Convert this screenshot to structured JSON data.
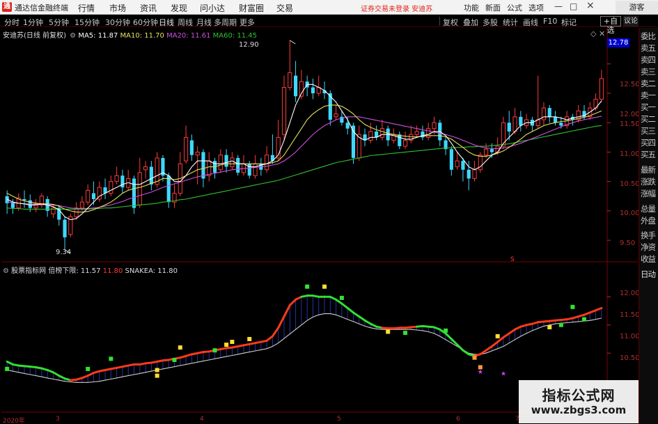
{
  "app": {
    "logo_text": "通",
    "title": "通达信金融终端"
  },
  "menu": [
    "行情",
    "市场",
    "资讯",
    "发现",
    "问小达",
    "财富圈",
    "交易"
  ],
  "trade_warning": "证券交易未登录 安迪苏",
  "top_right_buttons": [
    "功能",
    "新面",
    "公式",
    "选项"
  ],
  "window_controls": [
    "—",
    "□",
    "×"
  ],
  "guest_label": "游客",
  "periods": [
    "分时",
    "1分钟",
    "5分钟",
    "15分钟",
    "30分钟",
    "60分钟",
    "日线",
    "周线",
    "月线",
    "多周期",
    "更多"
  ],
  "active_period": "日线",
  "toolbar_right": [
    "复权",
    "叠加",
    "多股",
    "统计",
    "画线",
    "F10",
    "标记"
  ],
  "self_select_label": "+自选",
  "yk_label": "议论",
  "sidebar": {
    "top": "委比",
    "items": [
      "委比",
      "卖五",
      "卖四",
      "卖三",
      "卖二",
      "卖一",
      "买一",
      "买二",
      "买三",
      "买四",
      "买五",
      "最新",
      "涨跌",
      "涨幅",
      "总量",
      "外盘",
      "换手",
      "净资",
      "收益"
    ],
    "bottom": "日线"
  },
  "main_legend": {
    "stock": "安迪苏",
    "mode": "(日线 前复权)",
    "ma5_label": "MA5: 11.87",
    "ma10_label": "MA10: 11.70",
    "ma20_label": "MA20: 11.61",
    "ma60_label": "MA60: 11.45"
  },
  "price_axis": [
    "12.50",
    "12.00",
    "11.50",
    "11.00",
    "10.50",
    "10.00",
    "9.50"
  ],
  "current_price": "12.78",
  "high_marker": "12.90",
  "low_marker": "9.34",
  "flag_marker": "S",
  "indicator_legend": {
    "name": "股票指标网",
    "item1": "倍榜下限: 11.57",
    "item2": "11.80",
    "item3": "SNAKEA: 11.80"
  },
  "indicator_axis": [
    "12.00",
    "11.50",
    "11.00",
    "10.50"
  ],
  "indicator_panel_label": "日动",
  "x_axis": [
    "2020年",
    "3",
    "4",
    "5",
    "6",
    "7"
  ],
  "watermark": {
    "line1": "指标公式网",
    "line2": "www.zbgs3.com"
  },
  "colors": {
    "up": "#ff3b3b",
    "down": "#3fd8ff",
    "ma5": "#ffffff",
    "ma10": "#e8e060",
    "ma20": "#d050e0",
    "ma60": "#30c030",
    "accent": "#e0261e"
  },
  "chart_data": {
    "type": "candlestick",
    "ylim": [
      9.3,
      12.9
    ],
    "candles": [
      [
        10.25,
        10.13,
        10.35,
        9.95
      ],
      [
        10.15,
        10.05,
        10.2,
        9.95
      ],
      [
        10.05,
        10.22,
        10.3,
        10.0
      ],
      [
        10.2,
        10.18,
        10.35,
        10.05
      ],
      [
        10.18,
        10.05,
        10.28,
        9.98
      ],
      [
        10.05,
        10.12,
        10.2,
        9.98
      ],
      [
        10.1,
        10.25,
        10.3,
        10.05
      ],
      [
        10.2,
        10.0,
        10.25,
        9.9
      ],
      [
        9.95,
        10.05,
        10.1,
        9.88
      ],
      [
        10.05,
        9.85,
        10.1,
        9.75
      ],
      [
        9.85,
        9.55,
        9.9,
        9.34
      ],
      [
        9.6,
        9.9,
        9.95,
        9.55
      ],
      [
        9.9,
        10.05,
        10.15,
        9.85
      ],
      [
        10.05,
        10.15,
        10.25,
        10.0
      ],
      [
        10.15,
        10.35,
        10.45,
        10.1
      ],
      [
        10.3,
        10.2,
        10.5,
        10.1
      ],
      [
        10.2,
        10.4,
        10.5,
        10.15
      ],
      [
        10.4,
        10.3,
        10.55,
        10.2
      ],
      [
        10.3,
        10.5,
        10.6,
        10.25
      ],
      [
        10.5,
        10.6,
        10.75,
        10.45
      ],
      [
        10.6,
        10.4,
        10.7,
        10.3
      ],
      [
        10.4,
        10.55,
        10.7,
        10.35
      ],
      [
        10.55,
        10.05,
        10.6,
        9.95
      ],
      [
        10.1,
        10.65,
        10.9,
        10.05
      ],
      [
        10.7,
        10.75,
        10.85,
        10.55
      ],
      [
        10.75,
        10.45,
        10.85,
        10.35
      ],
      [
        10.45,
        10.9,
        11.0,
        10.4
      ],
      [
        10.9,
        10.6,
        10.95,
        10.5
      ],
      [
        10.6,
        10.15,
        10.65,
        10.05
      ],
      [
        10.15,
        10.3,
        10.45,
        10.05
      ],
      [
        10.3,
        10.8,
        11.0,
        10.25
      ],
      [
        10.85,
        11.25,
        11.45,
        10.8
      ],
      [
        11.2,
        10.95,
        11.3,
        10.85
      ],
      [
        10.95,
        11.0,
        11.1,
        10.45
      ],
      [
        11.0,
        10.55,
        11.05,
        10.4
      ],
      [
        10.6,
        10.85,
        11.0,
        10.5
      ],
      [
        10.85,
        10.65,
        10.9,
        10.55
      ],
      [
        10.7,
        10.95,
        11.05,
        10.65
      ],
      [
        10.95,
        10.75,
        11.05,
        10.65
      ],
      [
        10.75,
        10.9,
        11.0,
        10.7
      ],
      [
        10.9,
        10.65,
        10.95,
        10.6
      ],
      [
        10.65,
        10.8,
        10.95,
        10.6
      ],
      [
        10.8,
        10.6,
        10.85,
        10.55
      ],
      [
        10.6,
        10.8,
        10.95,
        10.55
      ],
      [
        10.8,
        10.7,
        10.9,
        10.6
      ],
      [
        10.7,
        10.95,
        11.1,
        10.65
      ],
      [
        10.95,
        10.85,
        11.3,
        10.8
      ],
      [
        10.9,
        11.25,
        11.55,
        10.85
      ],
      [
        11.3,
        12.1,
        12.3,
        11.2
      ],
      [
        12.1,
        12.35,
        12.9,
        12.05
      ],
      [
        12.3,
        11.95,
        12.55,
        11.85
      ],
      [
        11.95,
        12.2,
        12.4,
        11.9
      ],
      [
        12.2,
        12.1,
        12.3,
        11.95
      ],
      [
        12.1,
        12.0,
        12.25,
        11.9
      ],
      [
        12.0,
        12.1,
        12.3,
        11.95
      ],
      [
        12.05,
        12.0,
        12.2,
        11.9
      ],
      [
        12.0,
        11.55,
        12.05,
        11.45
      ],
      [
        11.6,
        11.65,
        11.8,
        11.55
      ],
      [
        11.6,
        11.5,
        11.7,
        11.45
      ],
      [
        11.5,
        11.4,
        11.6,
        11.3
      ],
      [
        11.45,
        10.9,
        11.5,
        10.8
      ],
      [
        10.9,
        11.3,
        11.45,
        10.85
      ],
      [
        11.3,
        11.2,
        11.4,
        11.1
      ],
      [
        11.2,
        11.35,
        11.5,
        11.15
      ],
      [
        11.35,
        11.25,
        11.45,
        11.2
      ],
      [
        11.25,
        11.4,
        11.55,
        11.2
      ],
      [
        11.4,
        11.2,
        11.45,
        11.1
      ],
      [
        11.2,
        11.3,
        11.4,
        11.15
      ],
      [
        11.3,
        11.1,
        11.35,
        11.05
      ],
      [
        11.1,
        11.2,
        11.35,
        11.05
      ],
      [
        11.2,
        11.3,
        11.45,
        11.15
      ],
      [
        11.3,
        11.35,
        11.45,
        11.25
      ],
      [
        11.35,
        11.25,
        11.45,
        11.2
      ],
      [
        11.25,
        11.4,
        11.5,
        11.2
      ],
      [
        11.4,
        11.5,
        11.6,
        11.3
      ],
      [
        11.5,
        11.2,
        11.55,
        11.1
      ],
      [
        11.2,
        11.05,
        11.25,
        10.95
      ],
      [
        11.05,
        10.7,
        11.1,
        10.6
      ],
      [
        10.75,
        10.85,
        11.0,
        10.7
      ],
      [
        10.85,
        10.7,
        10.9,
        10.5
      ],
      [
        10.7,
        10.55,
        10.85,
        10.35
      ],
      [
        10.55,
        10.7,
        10.85,
        10.5
      ],
      [
        10.7,
        10.95,
        11.0,
        10.65
      ],
      [
        10.95,
        11.05,
        11.15,
        10.9
      ],
      [
        11.05,
        11.0,
        11.15,
        10.9
      ],
      [
        11.0,
        11.1,
        11.25,
        10.95
      ],
      [
        11.1,
        11.5,
        11.6,
        11.05
      ],
      [
        11.5,
        11.35,
        11.7,
        11.2
      ],
      [
        11.35,
        11.6,
        11.75,
        11.3
      ],
      [
        11.6,
        11.45,
        11.7,
        11.35
      ],
      [
        11.45,
        11.55,
        11.65,
        11.4
      ],
      [
        11.55,
        11.45,
        11.6,
        11.35
      ],
      [
        11.45,
        11.55,
        12.3,
        11.4
      ],
      [
        11.55,
        11.75,
        11.85,
        11.45
      ],
      [
        11.75,
        11.6,
        11.8,
        11.5
      ],
      [
        11.6,
        11.5,
        11.7,
        11.45
      ],
      [
        11.5,
        11.45,
        11.6,
        11.4
      ],
      [
        11.45,
        11.6,
        11.7,
        11.4
      ],
      [
        11.6,
        11.55,
        11.65,
        11.45
      ],
      [
        11.55,
        11.7,
        11.8,
        11.5
      ],
      [
        11.7,
        11.6,
        11.8,
        11.55
      ],
      [
        11.6,
        11.75,
        11.85,
        11.55
      ],
      [
        11.75,
        11.9,
        12.0,
        11.7
      ],
      [
        11.9,
        12.25,
        12.4,
        11.85
      ]
    ],
    "ma5": [
      10.2,
      10.15,
      10.13,
      10.12,
      10.1,
      10.1,
      10.12,
      10.1,
      10.07,
      10.02,
      9.9,
      9.85,
      9.87,
      9.95,
      10.05,
      10.15,
      10.25,
      10.3,
      10.35,
      10.4,
      10.45,
      10.48,
      10.45,
      10.45,
      10.5,
      10.55,
      10.6,
      10.65,
      10.6,
      10.5,
      10.5,
      10.6,
      10.75,
      10.85,
      10.85,
      10.85,
      10.8,
      10.8,
      10.82,
      10.85,
      10.8,
      10.8,
      10.75,
      10.75,
      10.78,
      10.8,
      10.85,
      10.95,
      11.2,
      11.5,
      11.8,
      12.0,
      12.15,
      12.15,
      12.1,
      12.05,
      11.95,
      11.85,
      11.7,
      11.55,
      11.35,
      11.25,
      11.2,
      11.25,
      11.25,
      11.3,
      11.3,
      11.28,
      11.25,
      11.22,
      11.22,
      11.25,
      11.28,
      11.3,
      11.35,
      11.35,
      11.28,
      11.15,
      11.0,
      10.88,
      10.75,
      10.7,
      10.75,
      10.85,
      10.95,
      11.0,
      11.15,
      11.25,
      11.35,
      11.45,
      11.5,
      11.5,
      11.55,
      11.6,
      11.6,
      11.6,
      11.58,
      11.55,
      11.58,
      11.6,
      11.62,
      11.68,
      11.75,
      11.87
    ],
    "ma10": [
      10.3,
      10.25,
      10.2,
      10.17,
      10.15,
      10.13,
      10.12,
      10.12,
      10.11,
      10.08,
      10.03,
      10.0,
      9.98,
      9.98,
      9.99,
      10.02,
      10.06,
      10.1,
      10.15,
      10.22,
      10.3,
      10.35,
      10.38,
      10.4,
      10.43,
      10.47,
      10.5,
      10.55,
      10.55,
      10.53,
      10.55,
      10.6,
      10.65,
      10.7,
      10.72,
      10.75,
      10.75,
      10.78,
      10.8,
      10.8,
      10.8,
      10.8,
      10.8,
      10.8,
      10.8,
      10.8,
      10.82,
      10.85,
      10.95,
      11.1,
      11.25,
      11.4,
      11.55,
      11.65,
      11.72,
      11.78,
      11.8,
      11.8,
      11.78,
      11.72,
      11.65,
      11.55,
      11.47,
      11.42,
      11.38,
      11.35,
      11.32,
      11.3,
      11.28,
      11.27,
      11.26,
      11.26,
      11.27,
      11.28,
      11.28,
      11.28,
      11.26,
      11.22,
      11.15,
      11.08,
      11.0,
      10.95,
      10.93,
      10.93,
      10.95,
      10.98,
      11.02,
      11.08,
      11.15,
      11.22,
      11.3,
      11.35,
      11.4,
      11.45,
      11.48,
      11.5,
      11.52,
      11.53,
      11.55,
      11.57,
      11.59,
      11.62,
      11.66,
      11.7
    ],
    "ma20": [
      10.15,
      10.14,
      10.13,
      10.12,
      10.12,
      10.11,
      10.11,
      10.1,
      10.1,
      10.09,
      10.07,
      10.05,
      10.04,
      10.04,
      10.04,
      10.05,
      10.06,
      10.08,
      10.1,
      10.13,
      10.16,
      10.2,
      10.23,
      10.26,
      10.29,
      10.32,
      10.36,
      10.4,
      10.43,
      10.46,
      10.49,
      10.52,
      10.55,
      10.58,
      10.6,
      10.62,
      10.64,
      10.66,
      10.68,
      10.7,
      10.71,
      10.72,
      10.73,
      10.74,
      10.75,
      10.76,
      10.78,
      10.8,
      10.85,
      10.92,
      11.0,
      11.1,
      11.2,
      11.3,
      11.38,
      11.45,
      11.5,
      11.55,
      11.58,
      11.6,
      11.6,
      11.6,
      11.58,
      11.56,
      11.54,
      11.52,
      11.5,
      11.48,
      11.46,
      11.44,
      11.42,
      11.4,
      11.38,
      11.36,
      11.34,
      11.32,
      11.3,
      11.27,
      11.24,
      11.2,
      11.16,
      11.12,
      11.09,
      11.07,
      11.06,
      11.06,
      11.07,
      11.09,
      11.12,
      11.15,
      11.19,
      11.23,
      11.27,
      11.31,
      11.35,
      11.39,
      11.43,
      11.47,
      11.5,
      11.53,
      11.55,
      11.57,
      11.59,
      11.61
    ],
    "ma60": [
      10.05,
      10.04,
      10.04,
      10.03,
      10.03,
      10.03,
      10.03,
      10.03,
      10.03,
      10.03,
      10.03,
      10.03,
      10.03,
      10.03,
      10.03,
      10.04,
      10.04,
      10.05,
      10.05,
      10.06,
      10.07,
      10.08,
      10.09,
      10.1,
      10.11,
      10.12,
      10.13,
      10.15,
      10.16,
      10.17,
      10.19,
      10.2,
      10.22,
      10.24,
      10.26,
      10.28,
      10.3,
      10.32,
      10.34,
      10.36,
      10.38,
      10.4,
      10.42,
      10.44,
      10.46,
      10.48,
      10.5,
      10.52,
      10.55,
      10.58,
      10.61,
      10.64,
      10.67,
      10.7,
      10.73,
      10.76,
      10.79,
      10.82,
      10.84,
      10.86,
      10.88,
      10.9,
      10.92,
      10.94,
      10.95,
      10.96,
      10.97,
      10.98,
      10.99,
      11.0,
      11.01,
      11.02,
      11.03,
      11.04,
      11.05,
      11.06,
      11.07,
      11.07,
      11.08,
      11.08,
      11.09,
      11.09,
      11.1,
      11.1,
      11.11,
      11.12,
      11.13,
      11.14,
      11.16,
      11.18,
      11.2,
      11.22,
      11.24,
      11.26,
      11.28,
      11.3,
      11.32,
      11.34,
      11.36,
      11.38,
      11.4,
      11.42,
      11.44,
      11.45
    ],
    "indicator": {
      "ylim": [
        10.2,
        12.3
      ],
      "snake": [
        10.85,
        10.8,
        10.78,
        10.77,
        10.76,
        10.75,
        10.73,
        10.7,
        10.66,
        10.6,
        10.55,
        10.52,
        10.53,
        10.56,
        10.6,
        10.65,
        10.68,
        10.7,
        10.72,
        10.74,
        10.76,
        10.78,
        10.8,
        10.8,
        10.82,
        10.83,
        10.85,
        10.87,
        10.88,
        10.9,
        10.92,
        10.95,
        10.98,
        11.0,
        11.02,
        11.03,
        11.05,
        11.07,
        11.09,
        11.1,
        11.12,
        11.14,
        11.16,
        11.18,
        11.2,
        11.22,
        11.3,
        11.45,
        11.65,
        11.85,
        11.95,
        12.0,
        12.02,
        12.02,
        12.0,
        12.0,
        12.0,
        11.95,
        11.88,
        11.8,
        11.72,
        11.65,
        11.58,
        11.52,
        11.47,
        11.45,
        11.44,
        11.44,
        11.45,
        11.45,
        11.46,
        11.47,
        11.48,
        11.47,
        11.46,
        11.42,
        11.35,
        11.25,
        11.15,
        11.05,
        10.98,
        10.95,
        10.98,
        11.05,
        11.12,
        11.2,
        11.28,
        11.35,
        11.42,
        11.47,
        11.5,
        11.52,
        11.55,
        11.56,
        11.57,
        11.58,
        11.59,
        11.6,
        11.62,
        11.65,
        11.68,
        11.72,
        11.76,
        11.8
      ],
      "trend_up": [
        false,
        false,
        false,
        false,
        false,
        false,
        false,
        false,
        false,
        false,
        false,
        false,
        true,
        true,
        true,
        true,
        true,
        true,
        true,
        true,
        true,
        true,
        true,
        true,
        true,
        true,
        true,
        true,
        true,
        true,
        true,
        true,
        true,
        true,
        true,
        true,
        true,
        true,
        true,
        true,
        true,
        true,
        true,
        true,
        true,
        true,
        true,
        true,
        true,
        true,
        true,
        true,
        false,
        false,
        false,
        false,
        false,
        false,
        false,
        false,
        false,
        false,
        false,
        false,
        false,
        false,
        true,
        true,
        true,
        true,
        true,
        true,
        false,
        false,
        false,
        false,
        false,
        false,
        false,
        false,
        false,
        false,
        true,
        true,
        true,
        true,
        true,
        true,
        true,
        true,
        true,
        true,
        true,
        true,
        true,
        true,
        true,
        true,
        true,
        true,
        true,
        true,
        true,
        true
      ],
      "slow": [
        10.7,
        10.68,
        10.66,
        10.64,
        10.62,
        10.6,
        10.58,
        10.56,
        10.54,
        10.52,
        10.5,
        10.49,
        10.48,
        10.48,
        10.48,
        10.49,
        10.5,
        10.52,
        10.54,
        10.56,
        10.58,
        10.6,
        10.62,
        10.64,
        10.66,
        10.68,
        10.7,
        10.72,
        10.74,
        10.76,
        10.78,
        10.8,
        10.82,
        10.84,
        10.86,
        10.88,
        10.9,
        10.92,
        10.94,
        10.96,
        10.98,
        11.0,
        11.02,
        11.04,
        11.06,
        11.08,
        11.12,
        11.18,
        11.26,
        11.34,
        11.42,
        11.5,
        11.58,
        11.64,
        11.68,
        11.7,
        11.7,
        11.68,
        11.64,
        11.6,
        11.56,
        11.52,
        11.48,
        11.45,
        11.43,
        11.42,
        11.42,
        11.42,
        11.42,
        11.42,
        11.42,
        11.41,
        11.4,
        11.38,
        11.35,
        11.3,
        11.24,
        11.18,
        11.12,
        11.06,
        11.0,
        10.98,
        10.98,
        11.0,
        11.04,
        11.08,
        11.12,
        11.18,
        11.24,
        11.3,
        11.35,
        11.4,
        11.44,
        11.48,
        11.5,
        11.52,
        11.53,
        11.54,
        11.55,
        11.56,
        11.57,
        11.58,
        11.6,
        11.62
      ]
    }
  }
}
